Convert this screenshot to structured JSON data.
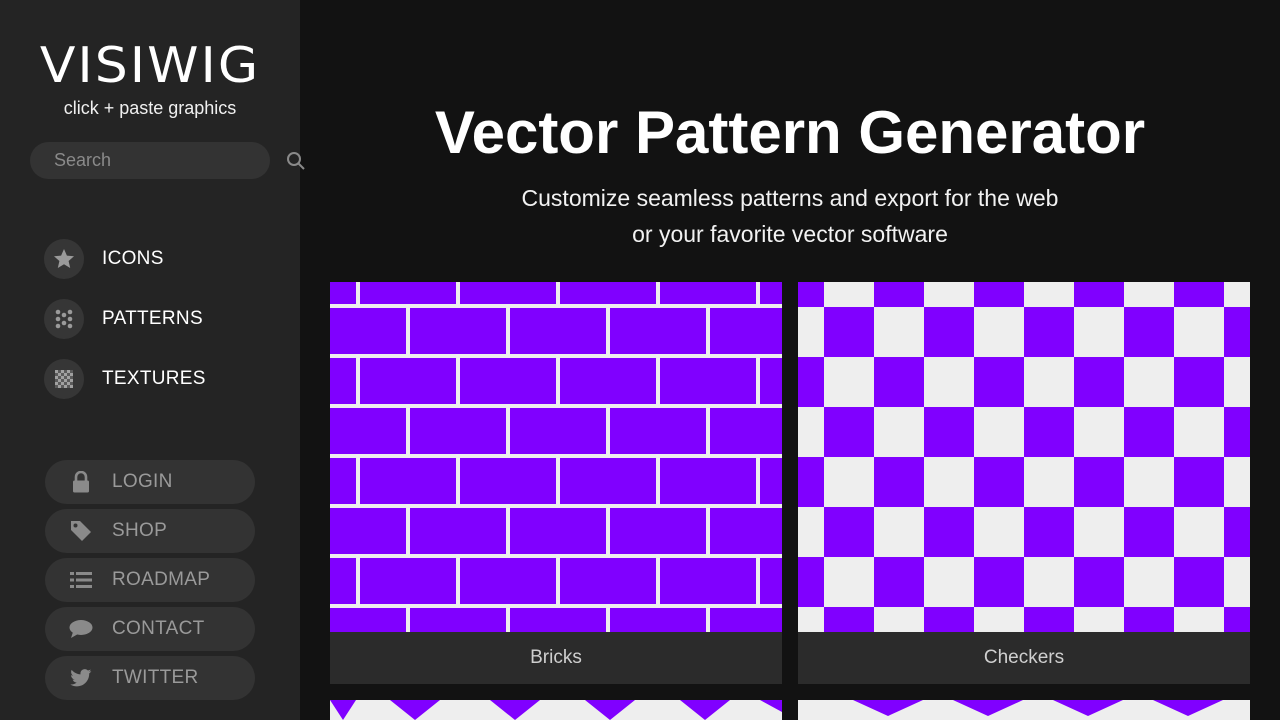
{
  "sidebar": {
    "logo": "VISIWIG",
    "tagline": "click + paste graphics",
    "search": {
      "placeholder": "Search",
      "value": ""
    },
    "nav": [
      {
        "label": "ICONS",
        "icon": "star-icon"
      },
      {
        "label": "PATTERNS",
        "icon": "dots-icon"
      },
      {
        "label": "TEXTURES",
        "icon": "texture-icon"
      }
    ],
    "links": [
      {
        "label": "LOGIN",
        "icon": "lock-icon"
      },
      {
        "label": "SHOP",
        "icon": "tag-icon"
      },
      {
        "label": "ROADMAP",
        "icon": "list-icon"
      },
      {
        "label": "CONTACT",
        "icon": "chat-icon"
      },
      {
        "label": "TWITTER",
        "icon": "twitter-icon"
      }
    ]
  },
  "main": {
    "title": "Vector Pattern Generator",
    "subtitle": "Customize seamless patterns and export for the web or your favorite vector software",
    "cards": [
      {
        "label": "Bricks",
        "pattern": "bricks-pattern"
      },
      {
        "label": "Checkers",
        "pattern": "checkers-pattern"
      }
    ]
  },
  "colors": {
    "accent": "#8000ff",
    "light": "#eeeeee",
    "sidebar_bg": "#242424",
    "page_bg": "#121212"
  }
}
